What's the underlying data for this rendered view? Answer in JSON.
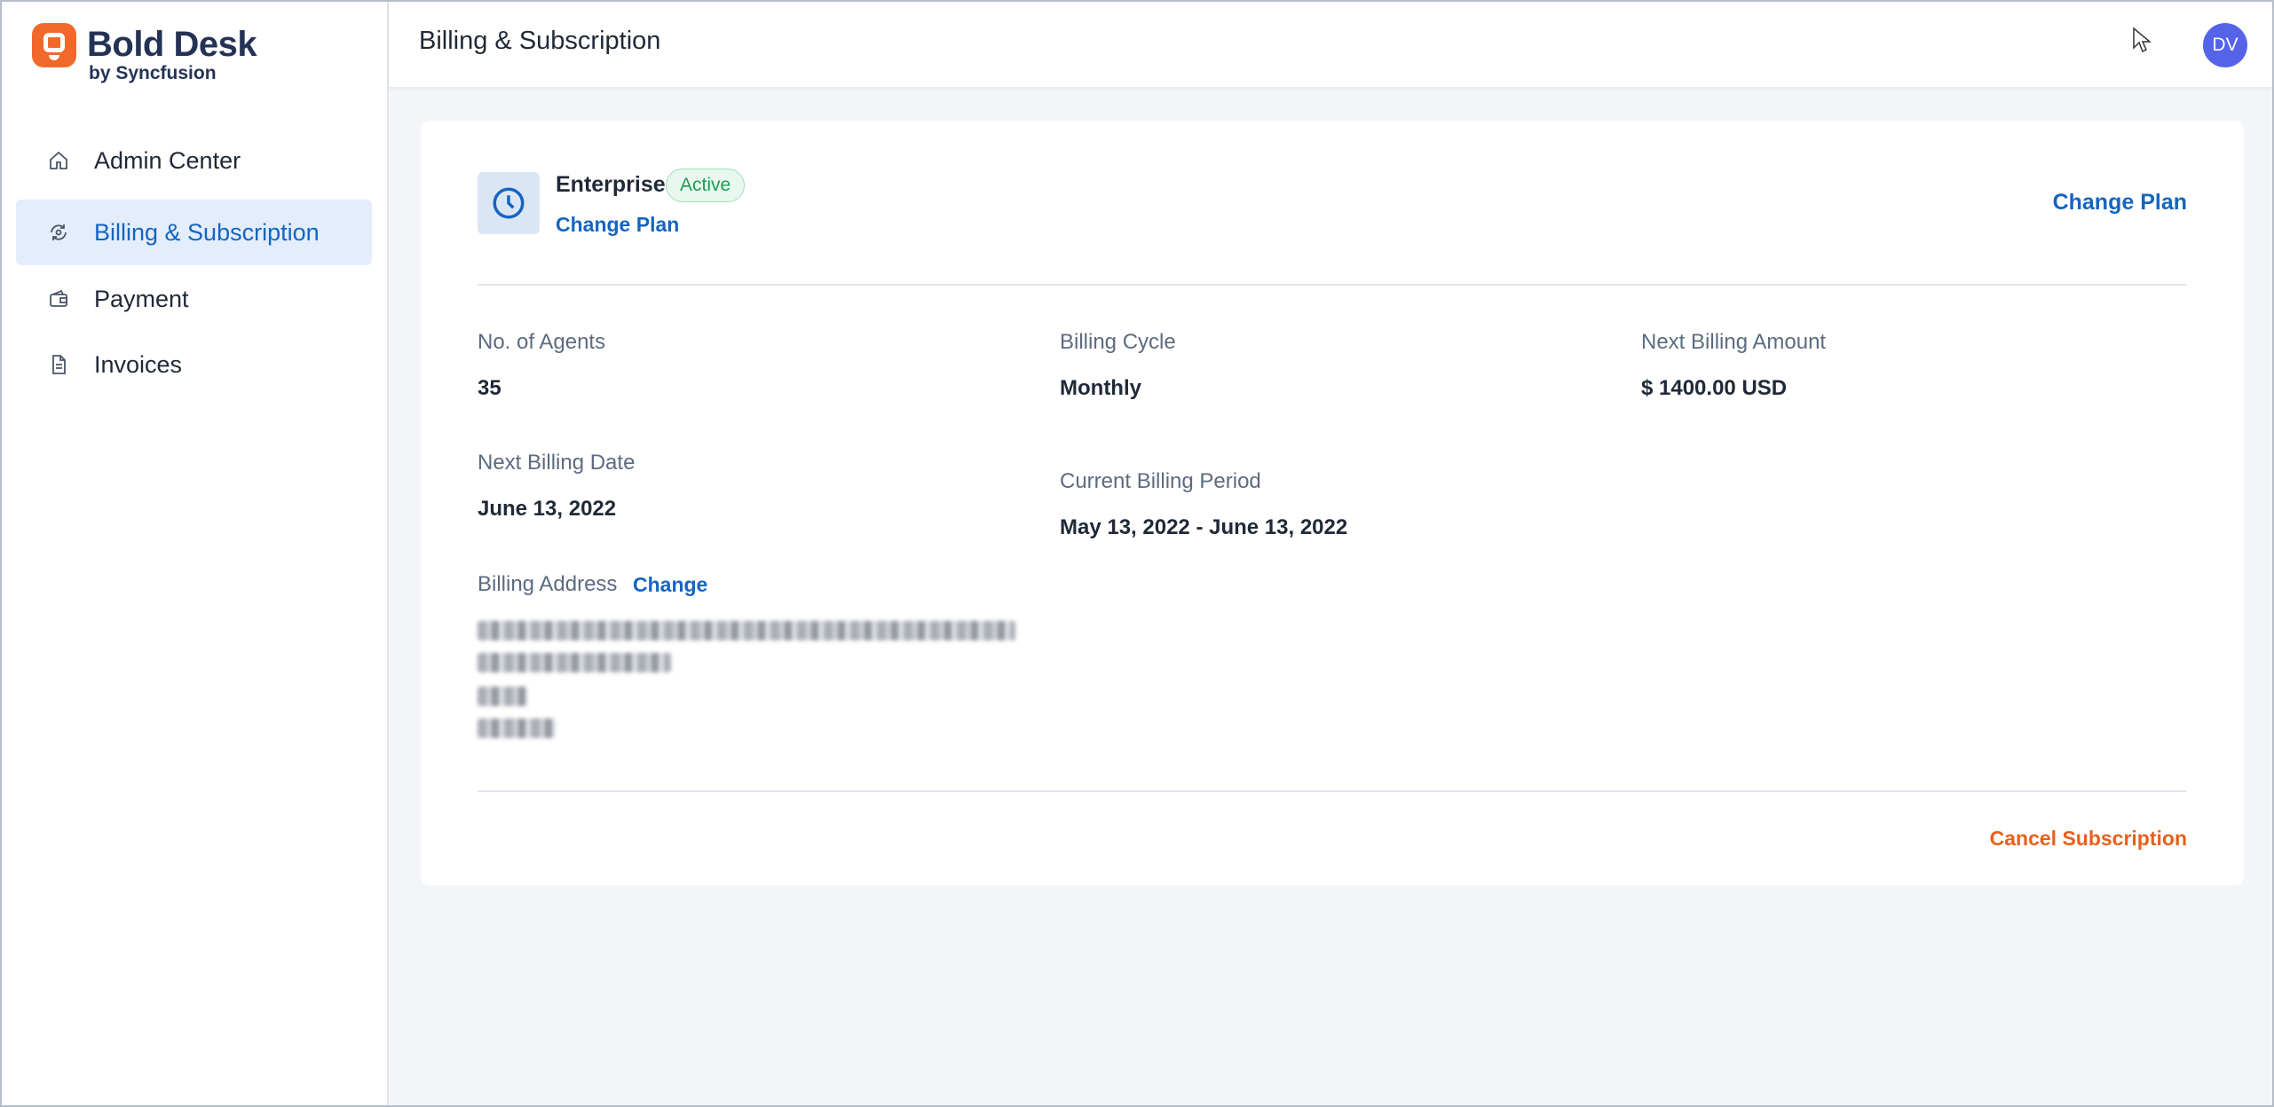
{
  "app": {
    "logo_text": "Bold Desk",
    "logo_sub": "by Syncfusion"
  },
  "header": {
    "title": "Billing & Subscription",
    "avatar_initials": "DV"
  },
  "sidebar": {
    "items": [
      {
        "label": "Admin Center",
        "icon": "home-icon"
      },
      {
        "label": "Billing & Subscription",
        "icon": "billing-icon",
        "active": true
      },
      {
        "label": "Payment",
        "icon": "wallet-icon"
      },
      {
        "label": "Invoices",
        "icon": "document-icon"
      }
    ]
  },
  "plan": {
    "name": "Enterprise",
    "status": "Active",
    "change_link": "Change Plan",
    "change_plan_right": "Change Plan"
  },
  "details": {
    "agents_label": "No. of Agents",
    "agents_value": "35",
    "cycle_label": "Billing Cycle",
    "cycle_value": "Monthly",
    "amount_label": "Next Billing Amount",
    "amount_value": "$ 1400.00 USD",
    "next_date_label": "Next Billing Date",
    "next_date_value": "June 13, 2022",
    "period_label": "Current Billing Period",
    "period_value": "May 13, 2022 - June 13, 2022",
    "address_label": "Billing Address",
    "address_change": "Change"
  },
  "footer": {
    "cancel_label": "Cancel Subscription"
  },
  "colors": {
    "accent": "#1565c0",
    "brand": "#f2682a",
    "active_badge": "#1e9e54",
    "cancel": "#e8601c"
  }
}
